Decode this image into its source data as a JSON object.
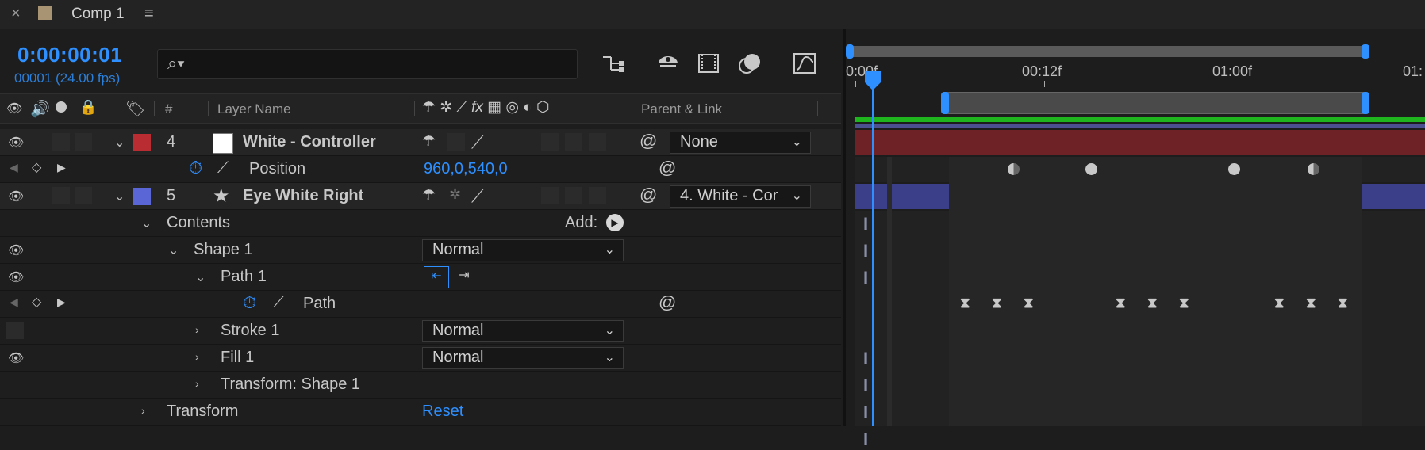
{
  "tab": {
    "close_glyph": "×",
    "title": "Comp 1",
    "menu_glyph": "≡",
    "comp_color": "#a89373"
  },
  "header": {
    "timecode": "0:00:00:01",
    "frame_fps": "00001 (24.00 fps)",
    "search_value": ""
  },
  "columns": {
    "num": "#",
    "layer_name": "Layer Name",
    "parent_link": "Parent & Link",
    "fx": "fx"
  },
  "layers": [
    {
      "num": "4",
      "name": "White - Controller",
      "color": "#b82c32",
      "parent": "None",
      "type": "solid"
    },
    {
      "num": "5",
      "name": "Eye White Right",
      "color": "#5b66d6",
      "parent": "4. White - Cor",
      "type": "shape"
    }
  ],
  "position": {
    "label": "Position",
    "value": "960,0,540,0"
  },
  "contents": {
    "label": "Contents",
    "add_label": "Add:"
  },
  "shape1": {
    "label": "Shape 1",
    "blend": "Normal"
  },
  "path1": {
    "label": "Path 1"
  },
  "path": {
    "label": "Path"
  },
  "stroke1": {
    "label": "Stroke 1",
    "blend": "Normal"
  },
  "fill1": {
    "label": "Fill 1",
    "blend": "Normal"
  },
  "transform_shape": {
    "label": "Transform: Shape 1"
  },
  "transform": {
    "label": "Transform",
    "reset": "Reset"
  },
  "timeline": {
    "ticks": [
      "0:00f",
      "00:12f",
      "01:00f",
      "01:"
    ],
    "layer4_bar_color": "#6e2226",
    "layer5_bar_color": "#3b3f8a",
    "work_area_color": "#1fb51f"
  },
  "colors": {
    "accent": "#2e8fff"
  }
}
